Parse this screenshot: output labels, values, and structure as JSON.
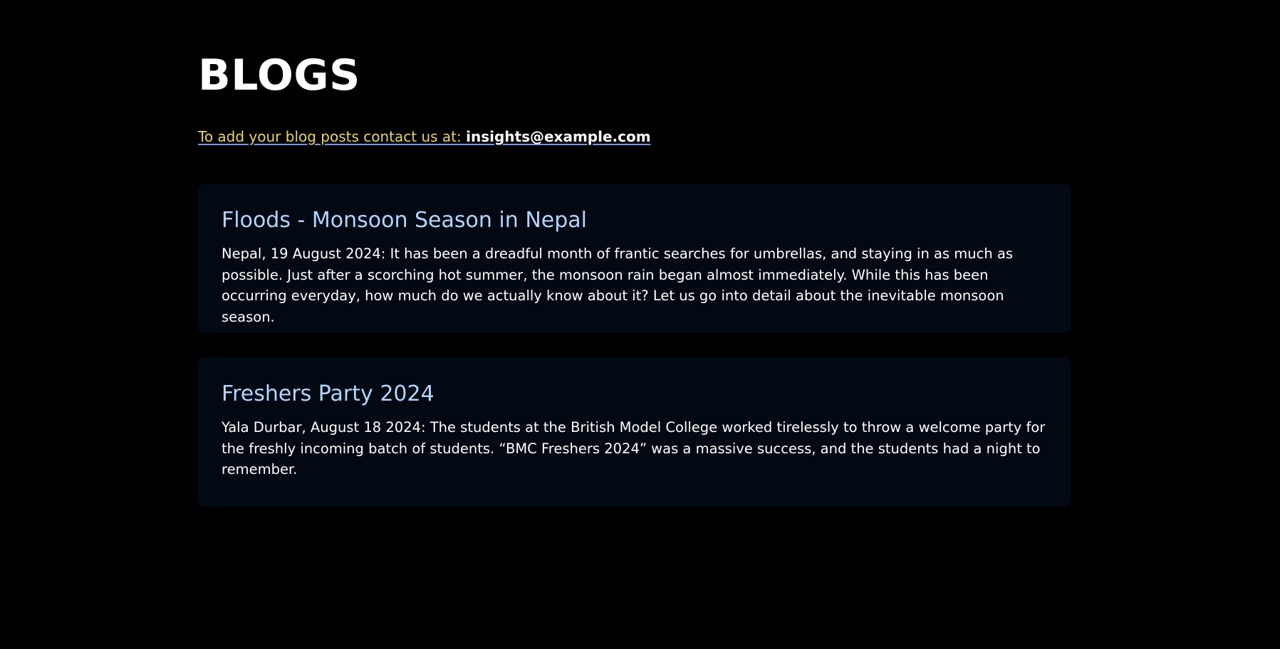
{
  "page": {
    "title": "BLOGS",
    "contact_prefix": "To add your blog posts contact us at: ",
    "contact_email": "insights@example.com"
  },
  "posts": [
    {
      "title": "Floods - Monsoon Season in Nepal",
      "body": "Nepal, 19 August 2024: It has been a dreadful month of frantic searches for umbrellas, and staying in as much as possible. Just after a scorching hot summer, the monsoon rain began almost immediately. While this has been occurring everyday, how much do we actually know about it? Let us go into detail about the inevitable monsoon season."
    },
    {
      "title": "Freshers Party 2024",
      "body": "Yala Durbar, August 18 2024: The students at the British Model College worked tirelessly to throw a welcome party for the freshly incoming batch of students. “BMC Freshers 2024” was a massive success, and the students had a night to remember."
    }
  ],
  "colors": {
    "background": "#000000",
    "card_background": "#030912",
    "card_title": "#b3d4ff",
    "contact_prefix": "#e6d66a",
    "underline": "#7a96e6"
  }
}
